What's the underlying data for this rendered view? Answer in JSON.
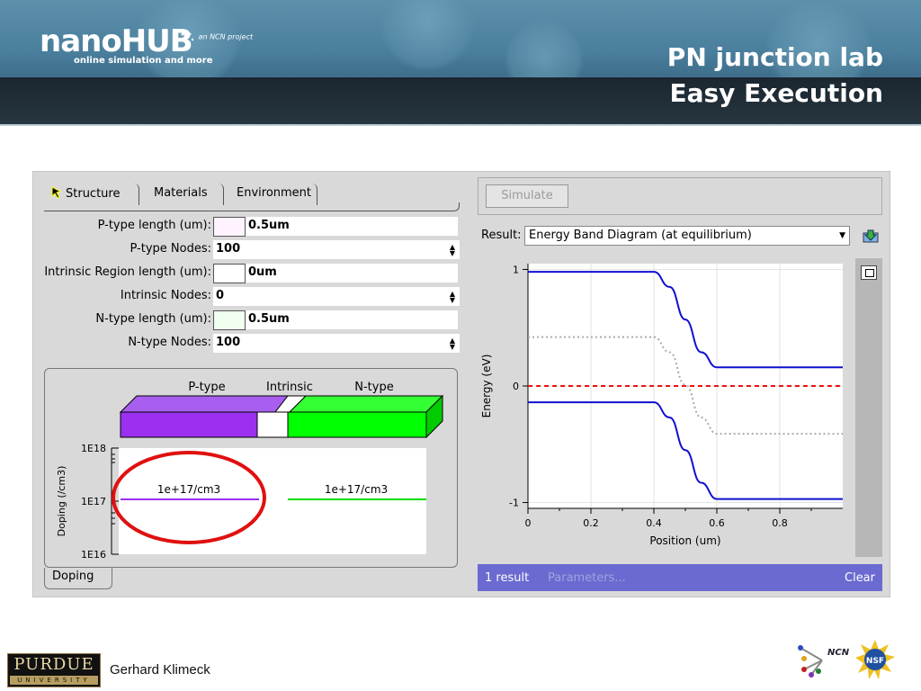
{
  "header": {
    "logo_text": "nanoHUB",
    "logo_tagline": "online simulation and more",
    "ncn_small": "an NCN project",
    "title_line1": "PN junction lab",
    "title_line2": "Easy Execution"
  },
  "tabs": [
    {
      "label": "Structure",
      "active": true
    },
    {
      "label": "Materials",
      "active": false
    },
    {
      "label": "Environment",
      "active": false
    }
  ],
  "form": [
    {
      "label": "P-type length (um):",
      "value": "0.5um",
      "swatch": "#fff3ff"
    },
    {
      "label": "P-type Nodes:",
      "value": "100",
      "spinner": true
    },
    {
      "label": "Intrinsic Region length (um):",
      "value": "0um",
      "swatch": "#ffffff"
    },
    {
      "label": "Intrinsic Nodes:",
      "value": "0",
      "spinner": true
    },
    {
      "label": "N-type length (um):",
      "value": "0.5um",
      "swatch": "#f0fff0"
    },
    {
      "label": "N-type Nodes:",
      "value": "100",
      "spinner": true
    }
  ],
  "doping": {
    "region_labels": [
      "P-type",
      "Intrinsic",
      "N-type"
    ],
    "colors": {
      "p": "#9b30f0",
      "n": "#00ff00",
      "i": "#ffffff",
      "highlight": "#e01010"
    },
    "ylabel": "Doping (/cm3)",
    "yticks": [
      "1E18",
      "1E17",
      "1E16"
    ],
    "p_label": "1e+17/cm3",
    "n_label": "1e+17/cm3",
    "tab_label": "Doping"
  },
  "right": {
    "simulate_label": "Simulate",
    "result_label": "Result:",
    "result_value": "Energy Band Diagram (at equilibrium)",
    "status_count": "1 result",
    "status_params": "Parameters...",
    "status_clear": "Clear"
  },
  "chart_data": {
    "type": "line",
    "xlabel": "Position (um)",
    "ylabel": "Energy (eV)",
    "xlim": [
      0,
      1
    ],
    "ylim": [
      -1.05,
      1.05
    ],
    "xticks": [
      0,
      0.2,
      0.4,
      0.6,
      0.8
    ],
    "yticks": [
      -1,
      0,
      1
    ],
    "grid": true,
    "series": [
      {
        "color": "#1010d0",
        "style": "solid",
        "x": [
          0,
          0.4,
          0.45,
          0.5,
          0.55,
          0.6,
          1
        ],
        "y": [
          0.98,
          0.98,
          0.85,
          0.57,
          0.29,
          0.16,
          0.16
        ]
      },
      {
        "color": "#1010d0",
        "style": "solid",
        "x": [
          0,
          0.4,
          0.45,
          0.5,
          0.55,
          0.6,
          1
        ],
        "y": [
          -0.14,
          -0.14,
          -0.27,
          -0.55,
          -0.83,
          -0.97,
          -0.97
        ]
      },
      {
        "color": "#ee1010",
        "style": "dashed",
        "x": [
          0,
          1
        ],
        "y": [
          0,
          0
        ]
      },
      {
        "color": "#aaaaaa",
        "style": "dotted",
        "x": [
          0,
          0.4,
          0.45,
          0.5,
          0.55,
          0.6,
          1
        ],
        "y": [
          0.42,
          0.42,
          0.29,
          0.01,
          -0.27,
          -0.41,
          -0.41
        ]
      }
    ]
  },
  "footer": {
    "university": "PURDUE",
    "university_sub": "UNIVERSITY",
    "author": "Gerhard Klimeck",
    "ncn_label": "NCN",
    "nsf_label": "NSF"
  }
}
